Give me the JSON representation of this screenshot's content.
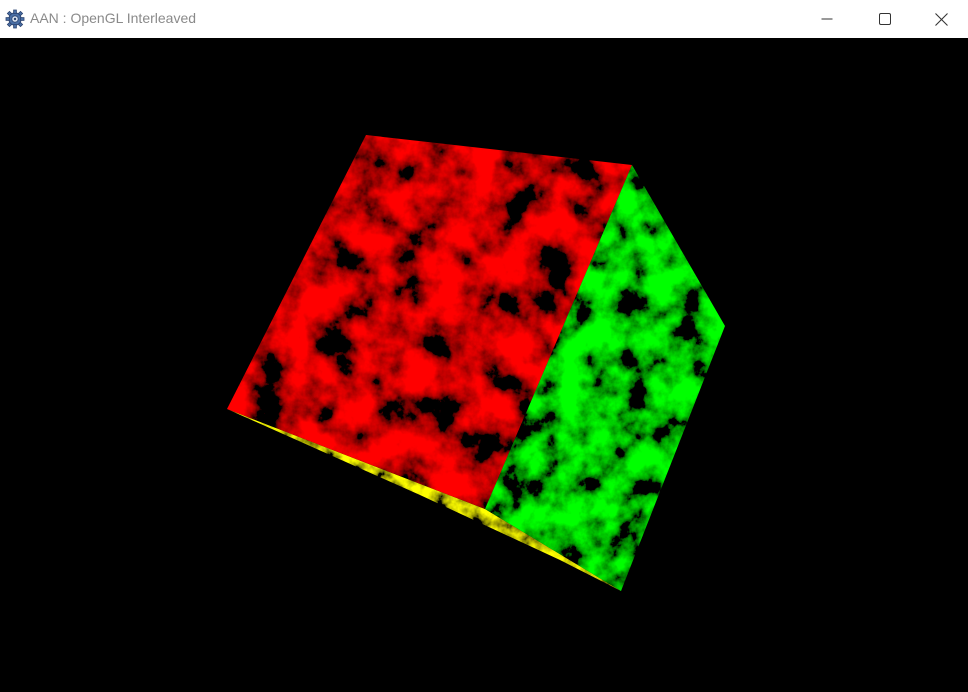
{
  "window": {
    "title": "AAN : OpenGL Interleaved",
    "icon": "app-gear-icon",
    "controls": {
      "minimize": "minimize-icon",
      "maximize": "maximize-icon",
      "close": "close-icon"
    }
  },
  "scene": {
    "background": "#000000",
    "object": "textured-cube",
    "faces": {
      "front": {
        "color": "#ff0000",
        "texture": "marble"
      },
      "right": {
        "color": "#00ff00",
        "texture": "marble"
      },
      "bottom": {
        "color": "#ffff00",
        "texture": "marble"
      }
    }
  }
}
